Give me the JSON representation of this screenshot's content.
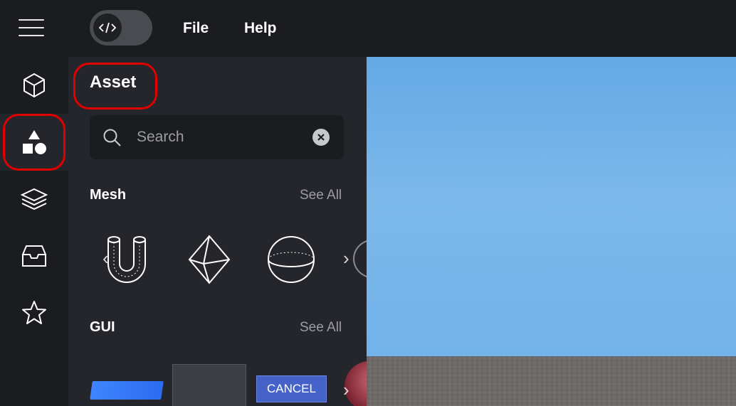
{
  "header": {
    "menu_icon": "hamburger-icon",
    "code_toggle_icon": "code-icon",
    "menu": [
      {
        "label": "File"
      },
      {
        "label": "Help"
      }
    ]
  },
  "rail": {
    "items": [
      {
        "icon": "cube-icon"
      },
      {
        "icon": "shapes-icon",
        "active": true
      },
      {
        "icon": "layers-icon"
      },
      {
        "icon": "inbox-icon"
      },
      {
        "icon": "star-icon"
      }
    ]
  },
  "panel": {
    "title": "Asset",
    "search": {
      "placeholder": "Search"
    },
    "mesh": {
      "title": "Mesh",
      "see_all": "See All",
      "items": [
        "u-shape-icon",
        "octahedron-icon",
        "sphere-icon"
      ]
    },
    "gui": {
      "title": "GUI",
      "see_all": "See All",
      "cancel_label": "CANCEL"
    }
  },
  "colors": {
    "background": "#1b1c20",
    "panel": "#25262b",
    "accent_button": "#4562c9",
    "annotation": "#e10000",
    "sky": "#6fb1ea",
    "ground": "#6f6a69"
  }
}
